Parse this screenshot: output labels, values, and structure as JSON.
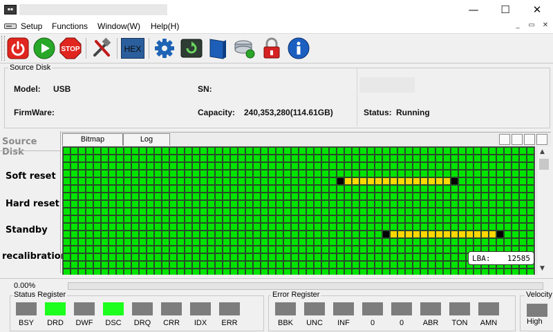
{
  "menu": {
    "items": [
      "Setup",
      "Functions",
      "Window(W)",
      "Help(H)"
    ]
  },
  "window_controls": {
    "minimize": "—",
    "maximize": "☐",
    "close": "✕"
  },
  "mdi_controls": {
    "minimize": "_",
    "restore": "▭",
    "close": "✕"
  },
  "toolbar": {
    "buttons": [
      "power-icon",
      "play-icon",
      "stop-icon",
      "tools-icon",
      "hex-icon",
      "gear-icon",
      "reset-icon",
      "book-icon",
      "disk-icon",
      "lock-icon",
      "info-icon"
    ],
    "stop_label": "STOP",
    "hex_label": "HEX"
  },
  "source_disk": {
    "group_title": "Source Disk",
    "model_label": "Model:",
    "model_value": "USB",
    "sn_label": "SN:",
    "sn_value": "",
    "firmware_label": "FirmWare:",
    "firmware_value": "",
    "capacity_label": "Capacity:",
    "capacity_value": "240,353,280(114.61GB)",
    "status_label": "Status:",
    "status_value": "Running"
  },
  "side_panel": {
    "title": "Source Disk",
    "buttons": [
      "Soft reset",
      "Hard reset",
      "Standby",
      "recalibration"
    ]
  },
  "tabs": [
    "Bitmap",
    "Log"
  ],
  "bitmap": {
    "cols": 62,
    "rows": 17,
    "colors": {
      "ok": "#00e400",
      "slow": "#ffd800",
      "bad": "#000000"
    },
    "segments": [
      {
        "row": 4,
        "start": 36,
        "end": 51
      },
      {
        "row": 11,
        "start": 42,
        "end": 57
      }
    ]
  },
  "lba": {
    "label": "LBA:",
    "value": "12585"
  },
  "progress": {
    "text": "0.00%",
    "fraction": 0.0
  },
  "status_register": {
    "title": "Status Register",
    "flags": [
      {
        "name": "BSY",
        "on": false
      },
      {
        "name": "DRD",
        "on": true
      },
      {
        "name": "DWF",
        "on": false
      },
      {
        "name": "DSC",
        "on": true
      },
      {
        "name": "DRQ",
        "on": false
      },
      {
        "name": "CRR",
        "on": false
      },
      {
        "name": "IDX",
        "on": false
      },
      {
        "name": "ERR",
        "on": false
      }
    ]
  },
  "error_register": {
    "title": "Error Register",
    "flags": [
      {
        "name": "BBK",
        "on": false
      },
      {
        "name": "UNC",
        "on": false
      },
      {
        "name": "INF",
        "on": false
      },
      {
        "name": "0",
        "on": false
      },
      {
        "name": "0",
        "on": false
      },
      {
        "name": "ABR",
        "on": false
      },
      {
        "name": "TON",
        "on": false
      },
      {
        "name": "AMN",
        "on": false
      }
    ]
  },
  "velocity": {
    "title": "Velocity",
    "value": "High"
  }
}
